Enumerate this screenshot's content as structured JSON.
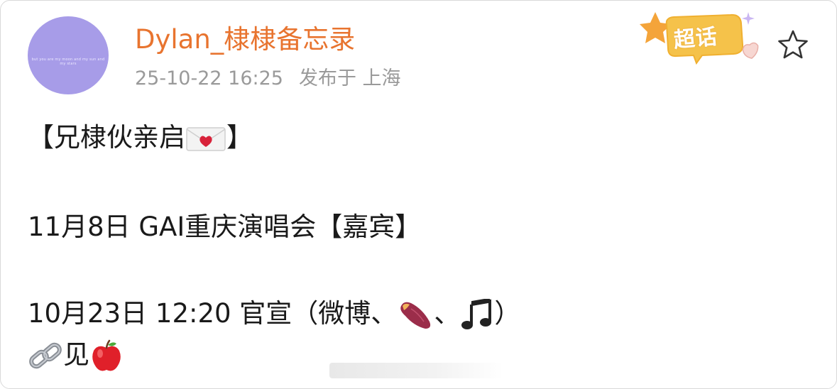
{
  "post": {
    "author": {
      "name": "Dylan_棣棣备忘录",
      "avatar_text": "but you are my moon and my sun and my stars"
    },
    "meta": {
      "time": "25-10-22 16:25",
      "location": "发布于 上海"
    },
    "super_topic_label": "超话",
    "content": {
      "line1_open": "【兄棣伙亲启",
      "line1_close": "】",
      "line2": "11月8日 GAI重庆演唱会【嘉宾】",
      "line3_a": "10月23日 12:20 官宣（微博、",
      "line3_sep": "、",
      "line3_close": "）",
      "line4": "见"
    },
    "icons": {
      "love_letter": "love-letter-emoji",
      "sweet_potato": "sweet-potato-emoji",
      "music_note": "music-note-emoji",
      "link": "link-emoji",
      "apple": "red-apple-emoji",
      "star": "star-outline-icon"
    },
    "colors": {
      "username": "#e8742f",
      "meta": "#9a9a9a",
      "avatar": "#a79ce8",
      "super_topic_badge": "#f5c24a"
    }
  }
}
